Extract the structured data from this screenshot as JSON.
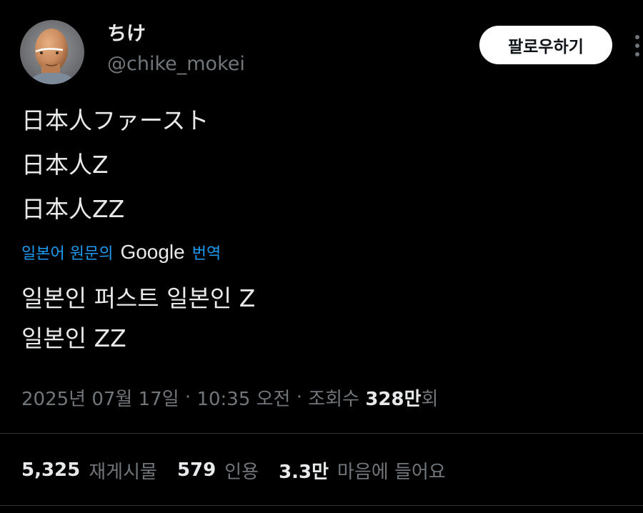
{
  "author": {
    "display_name": "ちけ",
    "handle": "@chike_mokei"
  },
  "follow_label": "팔로우하기",
  "more_icon": "more-dots-icon",
  "tweet_text": "日本人ファースト\n日本人Z\n日本人ZZ",
  "translation": {
    "source_label": "일본어 원문의",
    "provider": "Google",
    "action_label": "번역",
    "translated_text": "일본인 퍼스트 일본인 Z\n일본인 ZZ"
  },
  "meta": {
    "date": "2025년 07월 17일",
    "separator": " · ",
    "time": "10:35 오전",
    "views_label": "조회수",
    "views_count": "328만",
    "views_suffix": "회"
  },
  "stats": [
    {
      "count": "5,325",
      "label": "재게시물"
    },
    {
      "count": "579",
      "label": "인용"
    },
    {
      "count": "3.3만",
      "label": "마음에 들어요"
    }
  ],
  "colors": {
    "background": "#000000",
    "text": "#e7e9ea",
    "muted": "#71767b",
    "link": "#1d9bf0",
    "divider": "#2f3336"
  }
}
